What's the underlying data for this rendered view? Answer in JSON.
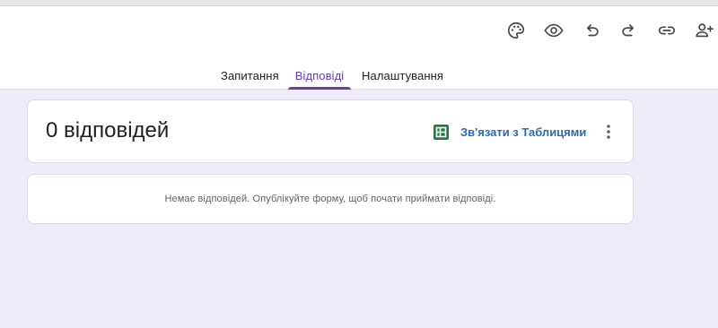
{
  "toolbar": {
    "icons": [
      "palette-icon",
      "preview-eye-icon",
      "undo-icon",
      "redo-icon",
      "link-icon",
      "add-collaborator-icon"
    ]
  },
  "tabs": [
    {
      "label": "Запитання",
      "active": false
    },
    {
      "label": "Відповіді",
      "active": true
    },
    {
      "label": "Налаштування",
      "active": false
    }
  ],
  "summary": {
    "response_count_title": "0 відповідей",
    "link_sheets_label": "Зв'язати з Таблицями"
  },
  "empty_state": {
    "message": "Немає відповідей. Опублікуйте форму, щоб почати приймати відповіді."
  },
  "colors": {
    "accent": "#673ab7",
    "page_background": "#f0ebf8",
    "sheets_green": "#188038",
    "link_blue": "#2b6ab5"
  }
}
